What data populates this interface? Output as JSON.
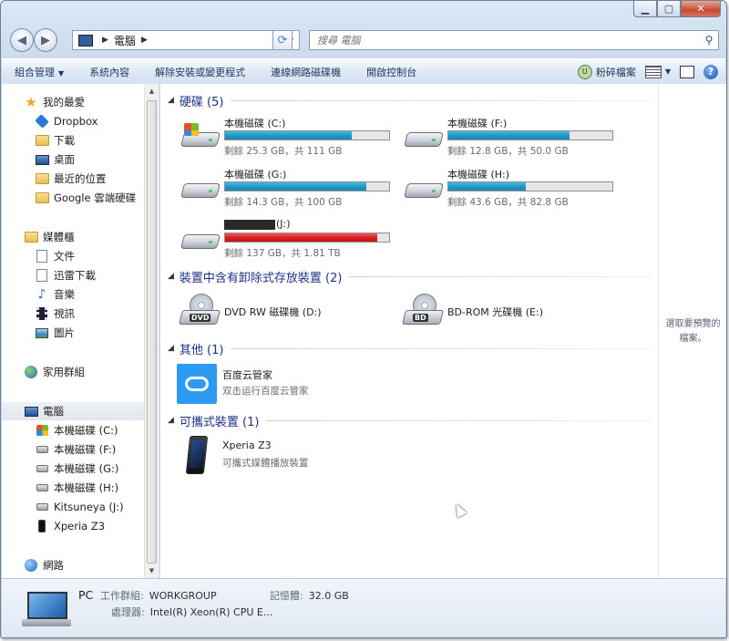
{
  "window": {
    "caption": {
      "min": "▁",
      "max": "▢",
      "close": "✕"
    }
  },
  "address": {
    "location": "電腦",
    "search_placeholder": "搜尋 電腦"
  },
  "toolbar": {
    "organize": "組合管理",
    "system_properties": "系統內容",
    "uninstall": "解除安裝或變更程式",
    "map_drive": "連線網路磁碟機",
    "control_panel": "開啟控制台",
    "shred": "粉碎檔案"
  },
  "nav": {
    "favorites": "我的最愛",
    "dropbox": "Dropbox",
    "downloads": "下載",
    "desktop": "桌面",
    "recent": "最近的位置",
    "google_drive": "Google 雲端硬碟",
    "libraries": "媒體櫃",
    "documents": "文件",
    "xunlei": "迅雷下載",
    "music": "音樂",
    "videos": "視訊",
    "pictures": "圖片",
    "homegroup": "家用群組",
    "computer": "電腦",
    "drive_c": "本機磁碟 (C:)",
    "drive_f": "本機磁碟 (F:)",
    "drive_g": "本機磁碟 (G:)",
    "drive_h": "本機磁碟 (H:)",
    "drive_j": "Kitsuneya (J:)",
    "xperia": "Xperia Z3",
    "network": "網路"
  },
  "groups": {
    "hdd": "硬碟 (5)",
    "removable": "裝置中含有卸除式存放裝置 (2)",
    "other": "其他 (1)",
    "portable": "可攜式裝置 (1)"
  },
  "drives": [
    {
      "name": "本機磁碟 (C:)",
      "free_text": "剩餘 25.3 GB，共 111 GB",
      "used_fraction": 0.77,
      "color": "#1f95c4"
    },
    {
      "name": "本機磁碟 (F:)",
      "free_text": "剩餘 12.8 GB，共 50.0 GB",
      "used_fraction": 0.74,
      "color": "#1f95c4"
    },
    {
      "name": "本機磁碟 (G:)",
      "free_text": "剩餘 14.3 GB，共 100 GB",
      "used_fraction": 0.86,
      "color": "#1f95c4"
    },
    {
      "name": "本機磁碟 (H:)",
      "free_text": "剩餘 43.6 GB，共 82.8 GB",
      "used_fraction": 0.47,
      "color": "#1f95c4"
    },
    {
      "name": "(J:)",
      "free_text": "剩餘 137 GB，共 1.81 TB",
      "used_fraction": 0.93,
      "color": "#d71f1f"
    }
  ],
  "optical": [
    {
      "name": "DVD RW 磁碟機 (D:)",
      "badge": "DVD"
    },
    {
      "name": "BD-ROM 光碟機 (E:)",
      "badge": "BD"
    }
  ],
  "other": {
    "name": "百度云管家",
    "sub": "双击运行百度云管家"
  },
  "portable": {
    "name": "Xperia Z3",
    "sub": "可攜式媒體播放裝置"
  },
  "preview": {
    "text": "選取要預覽的檔案。"
  },
  "details": {
    "name": "PC",
    "workgroup_label": "工作群組:",
    "workgroup": "WORKGROUP",
    "memory_label": "記憶體:",
    "memory": "32.0 GB",
    "cpu_label": "處理器:",
    "cpu": "Intel(R) Xeon(R) CPU E..."
  }
}
